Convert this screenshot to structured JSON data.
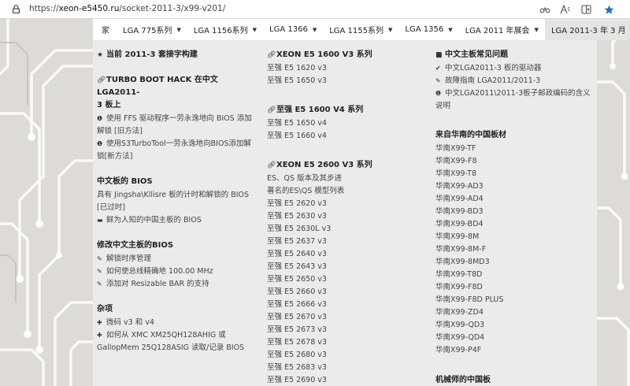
{
  "browser": {
    "url_prefix": "https://",
    "url_host": "xeon-e5450.ru",
    "url_path": "/socket-2011-3/x99-v201/"
  },
  "nav": {
    "items": [
      {
        "label": "家"
      },
      {
        "label": "LGA 775系列"
      },
      {
        "label": "LGA 1156系列"
      },
      {
        "label": "LGA 1366"
      },
      {
        "label": "LGA 1155系列"
      },
      {
        "label": "LGA 1356"
      },
      {
        "label": "LGA 2011 年展会"
      },
      {
        "label": "LGA 2011-3 年 3 月"
      }
    ],
    "caret": "▼"
  },
  "menu": {
    "col1": {
      "s1_title": "当前 2011-3 套接字构建",
      "s2_title_line1": "TURBO BOOT HACK 在中文 LGA2011-",
      "s2_title_line2": "3 板上",
      "s2_item1_line1": "使用 FFS 驱动程序一劳永逸地向 BIOS 添加",
      "s2_item1_line2": "解锁 [旧方法]",
      "s2_item2_line1": "使用S3TurboTool一劳永逸地向BIOS添加解",
      "s2_item2_line2": "锁[新方法]",
      "s3_title": "中文板的 BIOS",
      "s3_line1": "具有 Jingsha\\Kllisre 板的计时和解锁的 BIOS",
      "s3_line2": "[已过时]",
      "s3_item": "鲜为人知的中国主板的 BIOS",
      "s4_title": "修改中文主板的BIOS",
      "s4_items": [
        "解锁时序管理",
        "如何使总线精确地 100.00 MHz",
        "添加对 Resizable BAR 的支持"
      ],
      "s5_title": "杂项",
      "s5_item1": "微码 v3 和 v4",
      "s5_item2_line1": "如何从 XMC XM25QH128AHIG 或",
      "s5_item2_line2": "GallopMem 25Q128ASIG 读取/记录 BIOS"
    },
    "col2": {
      "s1_title": "XEON E5 1600 V3 系列",
      "s1_items": [
        "至强 E5 1620 v3",
        "至强 E5 1650 v3"
      ],
      "s2_title": "至强 E5 1600 V4 系列",
      "s2_items": [
        "至强 E5 1650 v4",
        "至强 E5 1660 v4"
      ],
      "s3_title": "XEON E5 2600 V3 系列",
      "s3_intro1": "ES、QS 版本及其步进",
      "s3_intro2": "著名的ES\\QS 模型列表",
      "s3_items": [
        "至强 E5 2620 v3",
        "至强 E5 2630 v3",
        "至强 E5 2630L v3",
        "至强 E5 2637 v3",
        "至强 E5 2640 v3",
        "至强 E5 2643 v3",
        "至强 E5 2650 v3",
        "至强 E5 2660 v3",
        "至强 E5 2666 v3",
        "至强 E5 2670 v3",
        "至强 E5 2673 v3",
        "至强 E5 2678 v3",
        "至强 E5 2680 v3",
        "至强 E5 2683 v3",
        "至强 E5 2690 v3"
      ]
    },
    "col3": {
      "s1_title": "中文主板常见问题",
      "s1_item1": "中文LGA2011-3 板的驱动器",
      "s1_item2": "故障指南 LGA2011/2011-3",
      "s1_item3_line1": "中文LGA2011\\2011-3板子邮政编码的含义",
      "s1_item3_line2": "说明",
      "s2_title": "来自华南的中国板材",
      "s2_items": [
        "华南X99-TF",
        "华南X99-F8",
        "华南X99-T8",
        "华南X99-AD3",
        "华南X99-AD4",
        "华南X99-BD3",
        "华南X99-BD4",
        "华南X99-8M",
        "华南X99-8M-F",
        "华南X99-8MD3",
        "华南X99-T8D",
        "华南X99-F8D",
        "华南X99-F8D PLUS",
        "华南X99-ZD4",
        "华南X99-QD3",
        "华南X99-QD4",
        "华南X99-P4F"
      ],
      "s3_title": "机械师的中国板"
    }
  }
}
